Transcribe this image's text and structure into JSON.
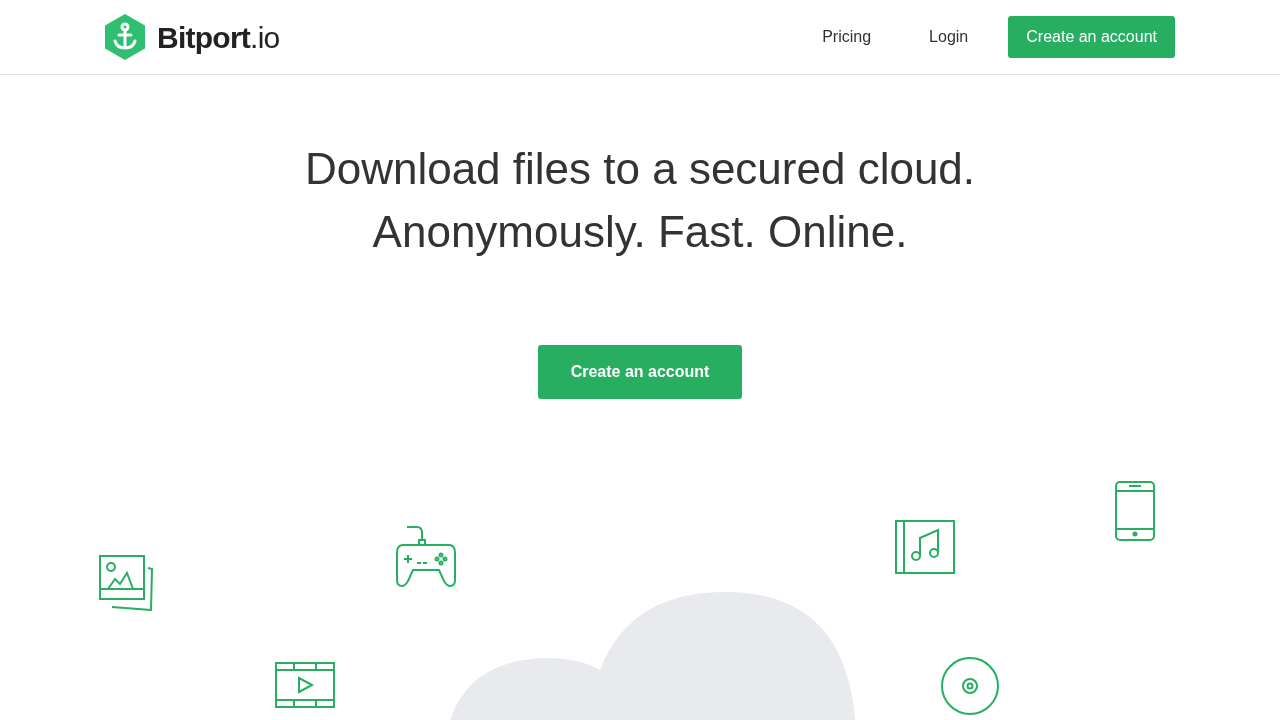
{
  "header": {
    "logo": "**Bitport**.io",
    "nav": [
      "Pricing",
      "Login"
    ],
    "cta": "Create an account"
  },
  "hero": {
    "headline": [
      "Download files to a secured cloud.",
      "Anonymously. Fast. Online."
    ],
    "cta": "Create an account"
  }
}
